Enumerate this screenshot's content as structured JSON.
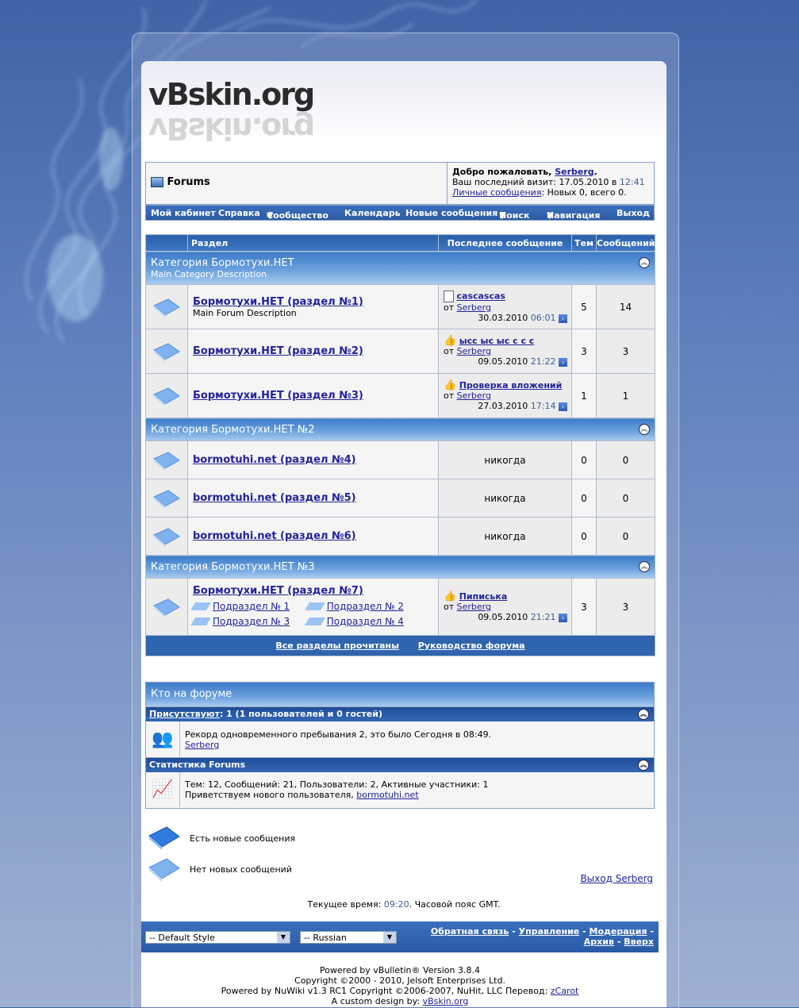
{
  "colors": {
    "nav": "#2c5aa3",
    "category": "#5a92d6",
    "link": "#22229c",
    "time": "#3e5c92"
  },
  "header": {
    "logo": "vBskin.org"
  },
  "breadcrumb": {
    "title": "Forums"
  },
  "welcome": {
    "greet": "Добро пожаловать,",
    "user": "Serberg",
    "dot": ".",
    "last_visit": "Ваш последний визит: 17.05.2010 в",
    "last_time": "12:41",
    "pm_link": "Личные сообщения",
    "pm_stats": ": Новых 0, всего 0."
  },
  "navbar": [
    "Мой кабинет",
    "Справка",
    "Сообщество",
    "Календарь",
    "Новые сообщения",
    "Поиск",
    "Навигация",
    "Выход"
  ],
  "table_head": {
    "section": "Раздел",
    "last_post": "Последнее сообщение",
    "threads": "Тем",
    "posts": "Сообщений"
  },
  "categories": [
    {
      "title": "Категория Бормотухи.НЕТ",
      "desc": "Main Category Description",
      "forums": [
        {
          "title": "Бормотухи.НЕТ (раздел №1)",
          "desc": "Main Forum Description",
          "lp_title": "cascascas",
          "lp_icon": "document-icon",
          "by": "от",
          "user": "Serberg",
          "date": "30.03.2010",
          "time": "06:01",
          "threads": "5",
          "posts": "14"
        },
        {
          "title": "Бормотухи.НЕТ (раздел №2)",
          "desc": "",
          "lp_title": "ысс ыс ыс с с с",
          "lp_icon": "thumbs-up-icon",
          "by": "от",
          "user": "Serberg",
          "date": "09.05.2010",
          "time": "21:22",
          "threads": "3",
          "posts": "3"
        },
        {
          "title": "Бормотухи.НЕТ (раздел №3)",
          "desc": "",
          "lp_title": "Проверка вложений",
          "lp_icon": "thumbs-up-icon",
          "by": "от",
          "user": "Serberg",
          "date": "27.03.2010",
          "time": "17:14",
          "threads": "1",
          "posts": "1"
        }
      ]
    },
    {
      "title": "Категория Бормотухи.НЕТ №2",
      "desc": "",
      "forums": [
        {
          "title": "bormotuhi.net (раздел №4)",
          "never": "никогда",
          "threads": "0",
          "posts": "0"
        },
        {
          "title": "bormotuhi.net (раздел №5)",
          "never": "никогда",
          "threads": "0",
          "posts": "0"
        },
        {
          "title": "bormotuhi.net (раздел №6)",
          "never": "никогда",
          "threads": "0",
          "posts": "0"
        }
      ]
    },
    {
      "title": "Категория Бормотухи.НЕТ №3",
      "desc": "",
      "forums": [
        {
          "title": "Бормотухи.НЕТ (раздел №7)",
          "subforums": [
            "Подраздел № 1",
            "Подраздел № 2",
            "Подраздел № 3",
            "Подраздел № 4"
          ],
          "lp_title": "Пиписька",
          "lp_icon": "thumbs-up-icon",
          "by": "от",
          "user": "Serberg",
          "date": "09.05.2010",
          "time": "21:21",
          "threads": "3",
          "posts": "3"
        }
      ]
    }
  ],
  "footer_links": {
    "mark_read": "Все разделы прочитаны",
    "guide": "Руководство форума"
  },
  "whos_online": {
    "title": "Кто на форуме",
    "present_label": "Присутствуют",
    "present_text": ": 1 (1 пользователей и 0 гостей)",
    "record": "Рекорд одновременного пребывания 2, это было Сегодня в 08:49.",
    "user": "Serberg",
    "stats_title": "Статистика Forums",
    "stats": "Тем: 12, Сообщений: 21, Пользователи: 2, Активные участники: 1",
    "welcome_new": "Приветствуем нового пользователя,",
    "new_user": "bormotuhi.net"
  },
  "legend": {
    "new": "Есть новые сообщения",
    "old": "Нет новых сообщений"
  },
  "logout": "Выход Serberg",
  "time": {
    "label": "Текущее время:",
    "value": "09:20",
    "suffix": ". Часовой пояс GMT."
  },
  "bottom": {
    "style_select": "-- Default Style",
    "lang_select": "-- Russian",
    "links": [
      "Обратная связь",
      "Управление",
      "Модерация",
      "Архив",
      "Вверх"
    ],
    "sep": "-"
  },
  "copyright": {
    "l1": "Powered by vBulletin® Version 3.8.4",
    "l2": "Copyright ©2000 - 2010, Jelsoft Enterprises Ltd.",
    "l3": "Powered by NuWiki v1.3 RC1 Copyright ©2006-2007, NuHit, LLC Перевод:",
    "l3_link": "zCarot",
    "l4": "A custom design by:",
    "l4_link": "vBskin.org"
  }
}
